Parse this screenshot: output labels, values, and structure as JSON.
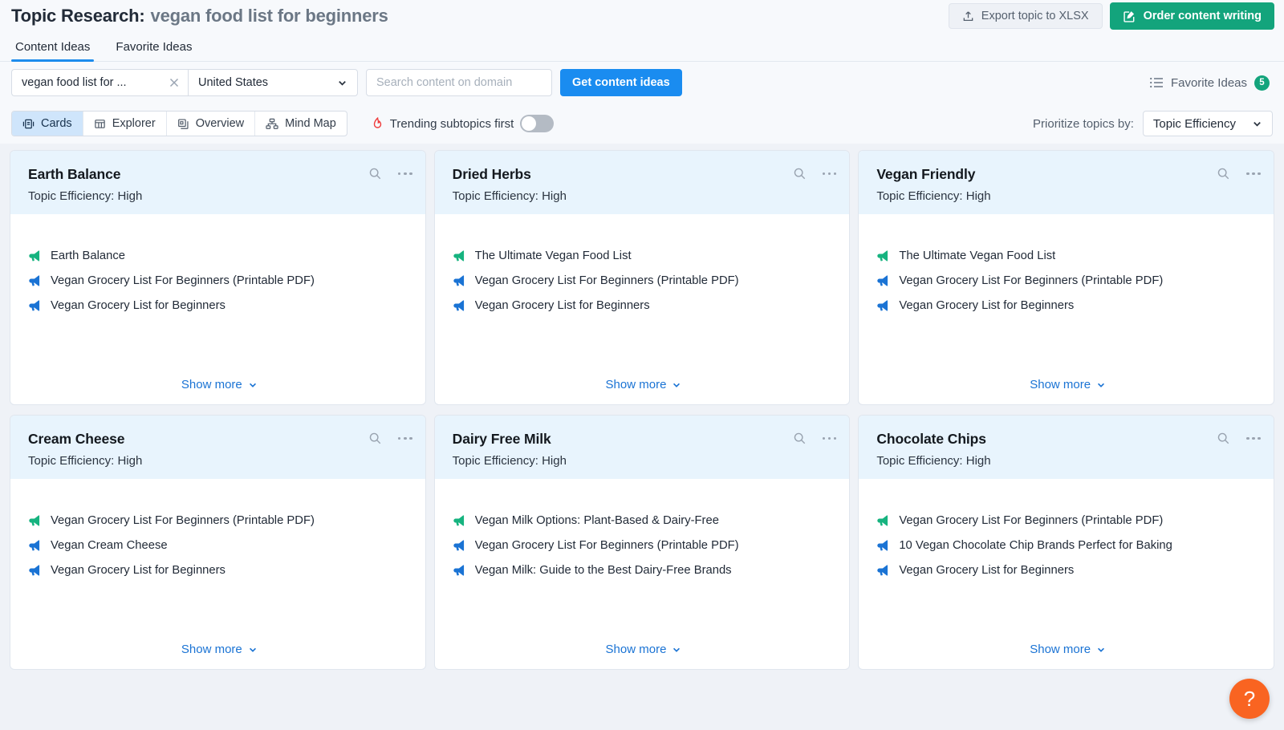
{
  "header": {
    "title_prefix": "Topic Research:",
    "subject": "vegan food list for beginners",
    "export_label": "Export topic to XLSX",
    "order_label": "Order content writing"
  },
  "tabs": [
    {
      "label": "Content Ideas",
      "active": true
    },
    {
      "label": "Favorite Ideas",
      "active": false
    }
  ],
  "search": {
    "keyword_value": "vegan food list for ...",
    "country_value": "United States",
    "domain_placeholder": "Search content on domain",
    "domain_value": "",
    "get_ideas_label": "Get content ideas",
    "favorite_ideas_label": "Favorite Ideas",
    "favorite_ideas_count": "5"
  },
  "views": {
    "items": [
      {
        "label": "Cards",
        "icon": "cards-icon",
        "active": true
      },
      {
        "label": "Explorer",
        "icon": "explorer-icon",
        "active": false
      },
      {
        "label": "Overview",
        "icon": "overview-icon",
        "active": false
      },
      {
        "label": "Mind Map",
        "icon": "mindmap-icon",
        "active": false
      }
    ],
    "trending_label": "Trending subtopics first",
    "trending_on": false,
    "prioritize_label": "Prioritize topics by:",
    "prioritize_value": "Topic Efficiency"
  },
  "show_more_label": "Show more",
  "colors": {
    "accent_blue": "#1a8cf0",
    "accent_green": "#13a47c",
    "link_blue": "#1a73d4",
    "idea_green": "#16b37f",
    "idea_blue": "#1a73d4",
    "flame_red": "#ef3a3a",
    "help_orange": "#f96421",
    "card_header_bg": "#e8f4fd",
    "page_bg": "#eff2f7"
  },
  "cards": [
    {
      "title": "Earth Balance",
      "efficiency": "Topic Efficiency: High",
      "ideas": [
        {
          "text": "Earth Balance",
          "color": "green"
        },
        {
          "text": "Vegan Grocery List For Beginners (Printable PDF)",
          "color": "blue"
        },
        {
          "text": "Vegan Grocery List for Beginners",
          "color": "blue"
        }
      ]
    },
    {
      "title": "Dried Herbs",
      "efficiency": "Topic Efficiency: High",
      "ideas": [
        {
          "text": "The Ultimate Vegan Food List",
          "color": "green"
        },
        {
          "text": "Vegan Grocery List For Beginners (Printable PDF)",
          "color": "blue"
        },
        {
          "text": "Vegan Grocery List for Beginners",
          "color": "blue"
        }
      ]
    },
    {
      "title": "Vegan Friendly",
      "efficiency": "Topic Efficiency: High",
      "ideas": [
        {
          "text": "The Ultimate Vegan Food List",
          "color": "green"
        },
        {
          "text": "Vegan Grocery List For Beginners (Printable PDF)",
          "color": "blue"
        },
        {
          "text": "Vegan Grocery List for Beginners",
          "color": "blue"
        }
      ]
    },
    {
      "title": "Cream Cheese",
      "efficiency": "Topic Efficiency: High",
      "ideas": [
        {
          "text": "Vegan Grocery List For Beginners (Printable PDF)",
          "color": "green"
        },
        {
          "text": "Vegan Cream Cheese",
          "color": "blue"
        },
        {
          "text": "Vegan Grocery List for Beginners",
          "color": "blue"
        }
      ]
    },
    {
      "title": "Dairy Free Milk",
      "efficiency": "Topic Efficiency: High",
      "ideas": [
        {
          "text": "Vegan Milk Options: Plant-Based & Dairy-Free",
          "color": "green"
        },
        {
          "text": "Vegan Grocery List For Beginners (Printable PDF)",
          "color": "blue"
        },
        {
          "text": "Vegan Milk: Guide to the Best Dairy-Free Brands",
          "color": "blue"
        }
      ]
    },
    {
      "title": "Chocolate Chips",
      "efficiency": "Topic Efficiency: High",
      "ideas": [
        {
          "text": "Vegan Grocery List For Beginners (Printable PDF)",
          "color": "green"
        },
        {
          "text": "10 Vegan Chocolate Chip Brands Perfect for Baking",
          "color": "blue"
        },
        {
          "text": "Vegan Grocery List for Beginners",
          "color": "blue"
        }
      ]
    }
  ],
  "help": {
    "label": "?"
  }
}
